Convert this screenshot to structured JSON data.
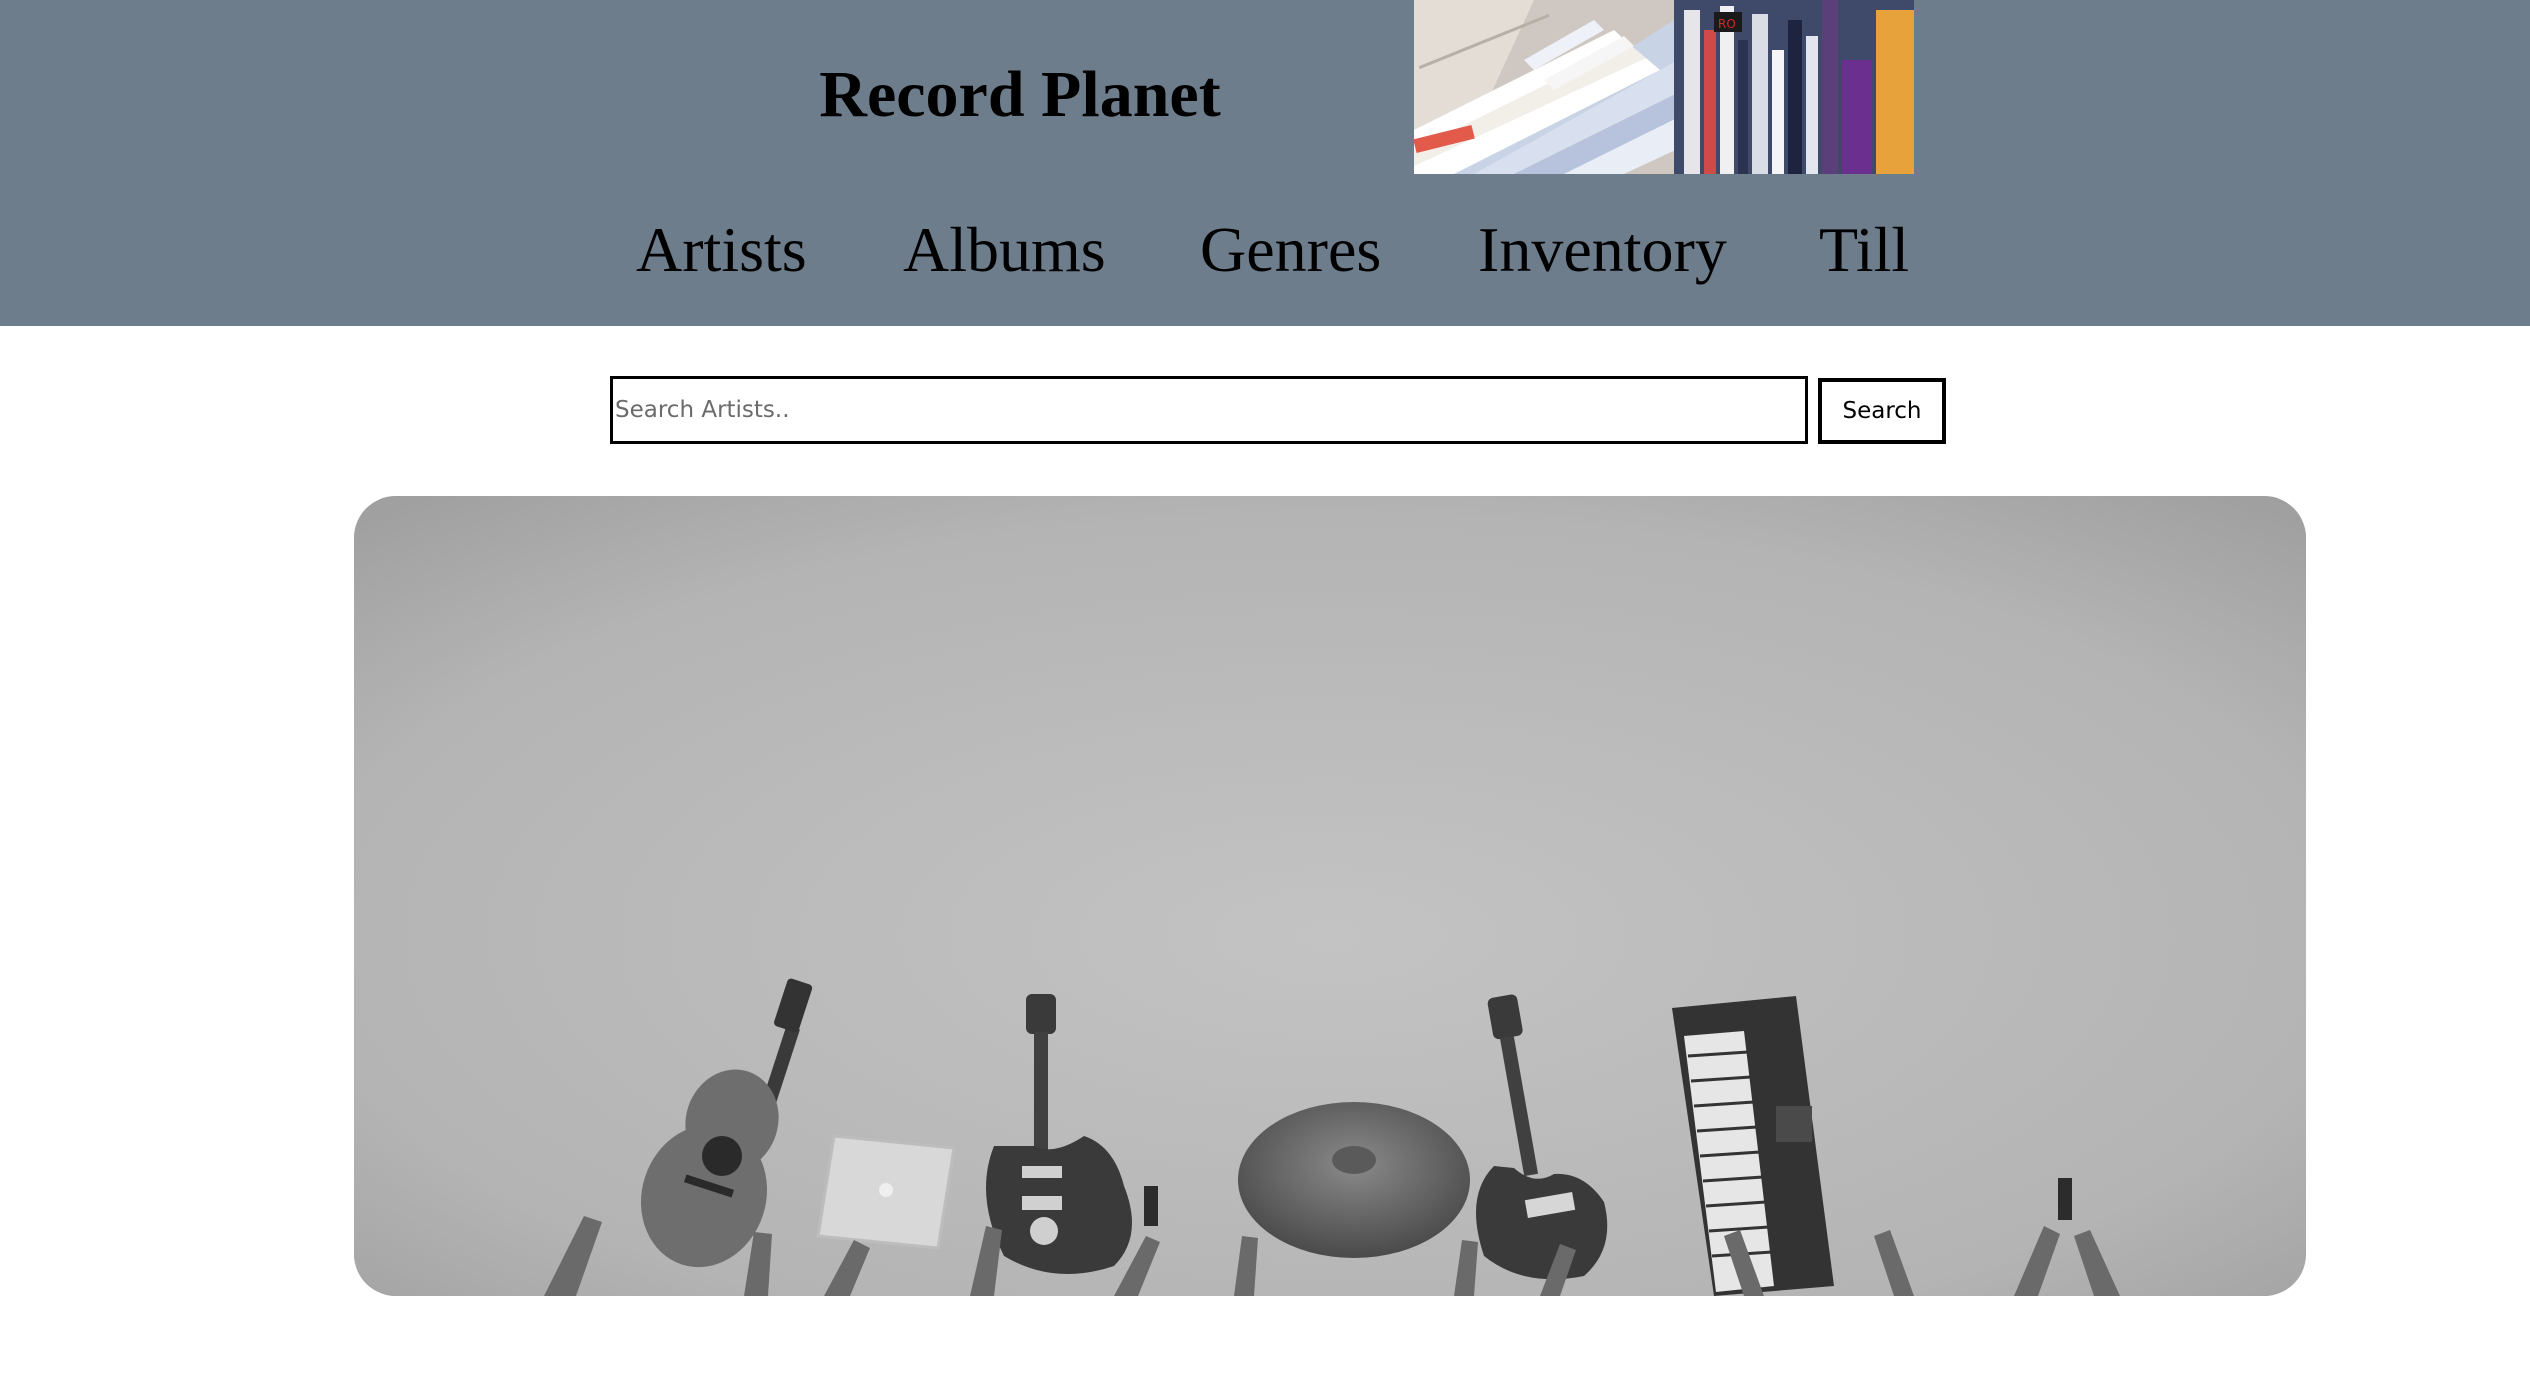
{
  "header": {
    "title": "Record Planet",
    "background_color": "#6e7d8c",
    "banner_image": "record-store-shelves-image"
  },
  "nav": {
    "items": [
      {
        "label": "Artists"
      },
      {
        "label": "Albums"
      },
      {
        "label": "Genres"
      },
      {
        "label": "Inventory"
      },
      {
        "label": "Till"
      }
    ]
  },
  "search": {
    "placeholder": "Search Artists..",
    "value": "",
    "button_label": "Search"
  },
  "hero": {
    "image": "musical-instruments-held-up-photo"
  }
}
